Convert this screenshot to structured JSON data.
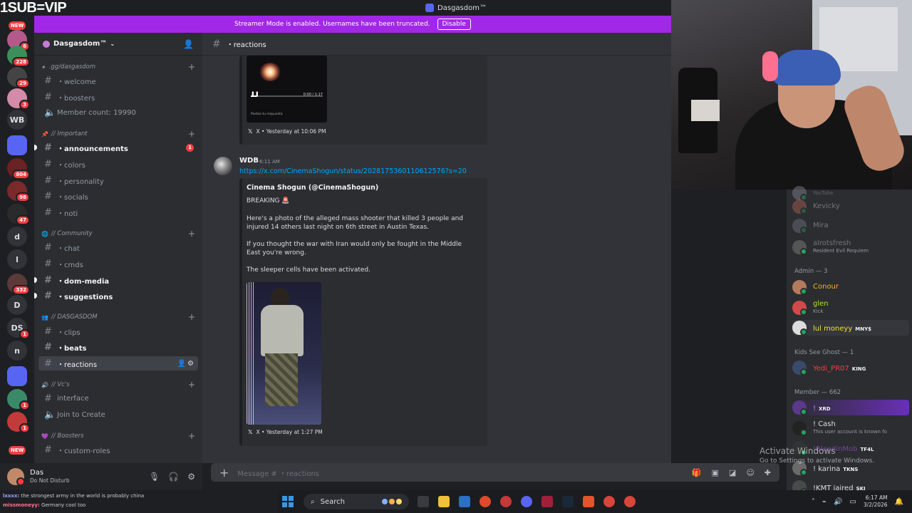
{
  "overlay": {
    "top_left_text": "1SUB=VIP"
  },
  "window": {
    "title": "Dasgasdom™"
  },
  "banner": {
    "text": "Streamer Mode is enabled. Usernames have been truncated.",
    "button": "Disable"
  },
  "rail": {
    "new_label": "NEW",
    "servers": [
      {
        "label": "",
        "badge": "6"
      },
      {
        "label": "",
        "badge": "228"
      },
      {
        "label": "",
        "badge": "29"
      },
      {
        "label": "",
        "badge": "3"
      },
      {
        "label": "WB",
        "badge": ""
      },
      {
        "label": "",
        "badge": ""
      },
      {
        "label": "",
        "badge": "804"
      },
      {
        "label": "",
        "badge": "98"
      },
      {
        "label": "",
        "badge": "47"
      },
      {
        "label": "d",
        "badge": ""
      },
      {
        "label": "l",
        "badge": ""
      },
      {
        "label": "",
        "badge": "332"
      },
      {
        "label": "D",
        "badge": ""
      },
      {
        "label": "DS",
        "badge": "1"
      },
      {
        "label": "n",
        "badge": ""
      },
      {
        "label": "",
        "badge": ""
      },
      {
        "label": "",
        "badge": "1"
      },
      {
        "label": "",
        "badge": "1"
      }
    ]
  },
  "sidebar": {
    "guild_name": "Dasgasdom™",
    "categories": {
      "c1": ".gg/dasgasdom",
      "c2": "// Important",
      "c3": "// Community",
      "c4": "// DASGASDOM",
      "c5": "// Vc's",
      "c6": "// Boosters"
    },
    "channels": {
      "welcome": "・welcome",
      "boosters": "・boosters",
      "member_count": "Member count: 19990",
      "announcements": "・announcements",
      "announcements_mentions": "1",
      "colors": "・colors",
      "personality": "・personality",
      "socials": "・socials",
      "noti": "・noti",
      "chat": "・chat",
      "cmds": "・cmds",
      "dom_media": "・dom-media",
      "suggestions": "・suggestions",
      "clips": "・clips",
      "beats": "・beats",
      "reactions": "・reactions",
      "interface": "interface",
      "join_to_create": "Join to Create",
      "custom_roles": "・custom-roles"
    }
  },
  "user": {
    "name": "Das",
    "status": "Do Not Disturb"
  },
  "chat": {
    "header": "・reactions",
    "embed1": {
      "video_time": "0:00 / 1:17",
      "video_caption": "Postea tu respuesta",
      "footer": "X • Yesterday at 10:06 PM"
    },
    "message": {
      "author": "WDB",
      "time": "6:11 AM",
      "link": "https://x.com/CinemaShogun/status/2028175360110612576?s=20",
      "embed_title": "Cinema Shogun (@CinemaShogun)",
      "line1": "BREAKING 🚨",
      "line2": "Here's a photo of the alleged mass shooter that killed 3 people and injured 14 others last night on 6th street in Austin Texas.",
      "line3": "If you thought the war with Iran would only be fought in the Middle East you're wrong.",
      "line4": "The sleeper cells have been activated.",
      "footer": "X • Yesterday at 1:27 PM"
    },
    "composer_placeholder": "Message # ・reactions"
  },
  "members": {
    "top": [
      {
        "name": "YouTube",
        "sub": ""
      },
      {
        "name": "Kevicky",
        "sub": ""
      },
      {
        "name": "Mira",
        "sub": ""
      },
      {
        "name": "alrotsfresh",
        "sub": "Resident Evil Requiem"
      }
    ],
    "admin_header": "Admin — 3",
    "admins": [
      {
        "name": "Conour",
        "sub": "",
        "tag": "",
        "color": "#f0b232"
      },
      {
        "name": "glen",
        "sub": "Kick",
        "tag": "",
        "color": "#b5e61d"
      },
      {
        "name": "lul moneyy",
        "sub": "",
        "tag": "MNY$",
        "color": "#f0e130"
      }
    ],
    "ghost_header": "Kids See Ghost — 1",
    "ghosts": [
      {
        "name": "Yedi_PR07",
        "sub": "",
        "tag": "KING",
        "color": "#f23f42"
      }
    ],
    "member_header": "Member — 662",
    "members": [
      {
        "name": "!",
        "sub": "",
        "tag": "XRD",
        "color": "#c084fc"
      },
      {
        "name": "! Cash",
        "sub": "This user account is known fo",
        "tag": "",
        "color": "#dbdee1"
      },
      {
        "name": "!BleedinMob",
        "sub": "",
        "tag": "TF4L",
        "color": "#b65cff"
      },
      {
        "name": "! karina",
        "sub": "",
        "tag": "TKNS",
        "color": "#dbdee1"
      },
      {
        "name": "!KMT jaired",
        "sub": "",
        "tag": "SKI",
        "color": "#dbdee1"
      }
    ]
  },
  "watermark": {
    "line1": "Activate Windows",
    "line2": "Go to Settings to activate Windows."
  },
  "stream_chat": {
    "line1_user": "lxxxx:",
    "line1_text": "the strongest army in the world is probably china",
    "line2_user": "missmoneyy:",
    "line2_text": "Germany cool too"
  },
  "taskbar": {
    "search_label": "Search",
    "time": "6:17 AM",
    "date": "3/2/2026"
  }
}
